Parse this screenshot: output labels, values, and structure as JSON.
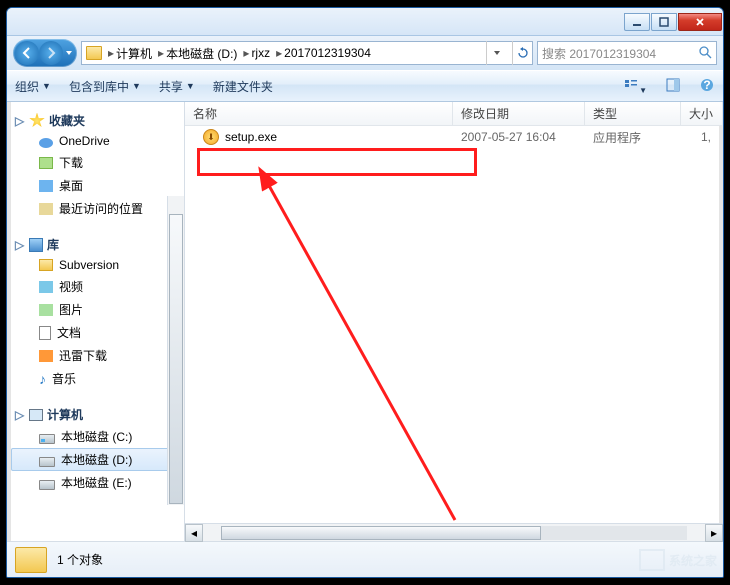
{
  "titlebar": {
    "min": "_",
    "max": "□",
    "close": "×"
  },
  "breadcrumb": {
    "root": "计算机",
    "d": "本地磁盘 (D:)",
    "f1": "rjxz",
    "f2": "2017012319304"
  },
  "search": {
    "placeholder": "搜索 2017012319304"
  },
  "toolbar": {
    "organize": "组织",
    "include": "包含到库中",
    "share": "共享",
    "newfolder": "新建文件夹"
  },
  "sidebar": {
    "fav": "收藏夹",
    "onedrive": "OneDrive",
    "downloads": "下载",
    "desktop": "桌面",
    "recent": "最近访问的位置",
    "libs": "库",
    "subversion": "Subversion",
    "video": "视频",
    "pictures": "图片",
    "docs": "文档",
    "thunder": "迅雷下载",
    "music": "音乐",
    "computer": "计算机",
    "drive_c": "本地磁盘 (C:)",
    "drive_d": "本地磁盘 (D:)",
    "drive_e": "本地磁盘 (E:)"
  },
  "columns": {
    "name": "名称",
    "date": "修改日期",
    "type": "类型",
    "size": "大小"
  },
  "rows": [
    {
      "name": "setup.exe",
      "date": "2007-05-27 16:04",
      "type": "应用程序",
      "size": "1,"
    }
  ],
  "status": {
    "text": "1 个对象"
  },
  "watermark": "系统之家"
}
